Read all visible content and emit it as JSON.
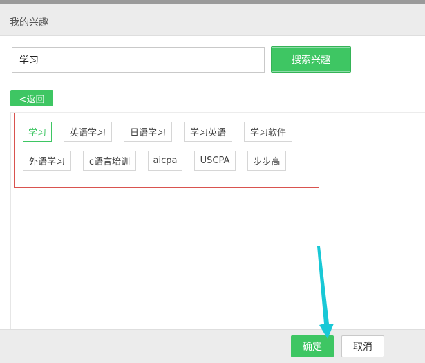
{
  "header": {
    "title": "我的兴趣"
  },
  "search": {
    "value": "学习",
    "button_label": "搜索兴趣"
  },
  "nav": {
    "back_label": "<返回"
  },
  "tags": [
    {
      "label": "学习",
      "selected": true
    },
    {
      "label": "英语学习",
      "selected": false
    },
    {
      "label": "日语学习",
      "selected": false
    },
    {
      "label": "学习英语",
      "selected": false
    },
    {
      "label": "学习软件",
      "selected": false
    },
    {
      "label": "外语学习",
      "selected": false
    },
    {
      "label": "c语言培训",
      "selected": false
    },
    {
      "label": "aicpa",
      "selected": false
    },
    {
      "label": "USCPA",
      "selected": false
    },
    {
      "label": "步步高",
      "selected": false
    }
  ],
  "footer": {
    "ok_label": "确定",
    "cancel_label": "取消"
  },
  "colors": {
    "accent": "#3ec663",
    "highlight_border": "#d9534f",
    "annotation_arrow": "#19c8d6"
  }
}
